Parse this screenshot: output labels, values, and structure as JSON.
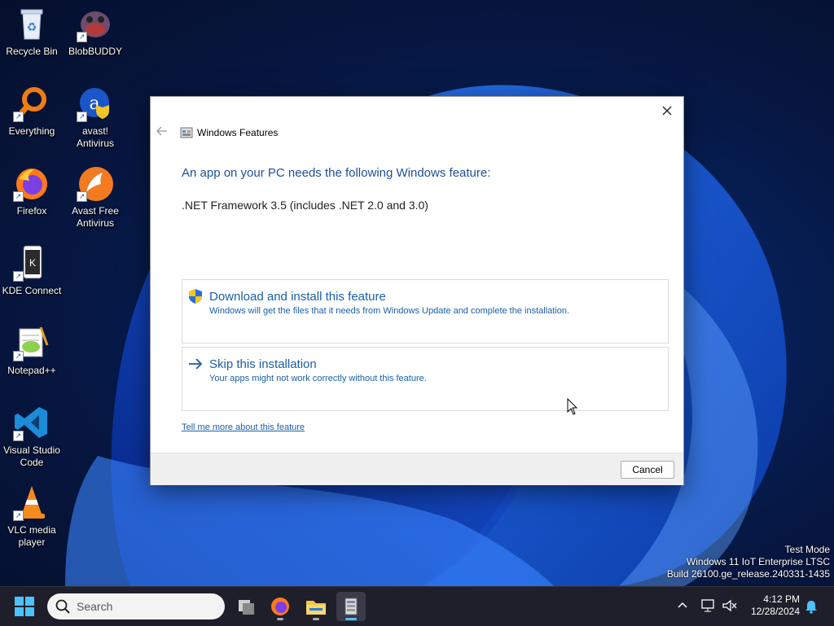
{
  "desktop": {
    "icons": [
      {
        "label": "Recycle Bin"
      },
      {
        "label": "BlobBUDDY"
      },
      {
        "label": "Everything"
      },
      {
        "label": "avast! Antivirus"
      },
      {
        "label": "Firefox"
      },
      {
        "label": "Avast Free Antivirus"
      },
      {
        "label": "KDE Connect"
      },
      {
        "label": "Notepad++"
      },
      {
        "label": "Visual Studio Code"
      },
      {
        "label": "VLC media player"
      }
    ]
  },
  "watermark": {
    "line1": "Test Mode",
    "line2": "Windows 11 IoT Enterprise LTSC",
    "line3": "Build 26100.ge_release.240331-1435"
  },
  "dialog": {
    "window_title": "Windows Features",
    "heading": "An app on your PC needs the following Windows feature:",
    "feature_name": ".NET Framework 3.5 (includes .NET 2.0 and 3.0)",
    "options": [
      {
        "title": "Download and install this feature",
        "description": "Windows will get the files that it needs from Windows Update and complete the installation."
      },
      {
        "title": "Skip this installation",
        "description": "Your apps might not work correctly without this feature."
      }
    ],
    "link": "Tell me more about this feature",
    "cancel_label": "Cancel"
  },
  "taskbar": {
    "search_placeholder": "Search",
    "time": "4:12 PM",
    "date": "12/28/2024"
  },
  "colors": {
    "accent": "#1a5fa8",
    "heading": "#1c4f9b",
    "taskbar": "#1f1f2b"
  }
}
